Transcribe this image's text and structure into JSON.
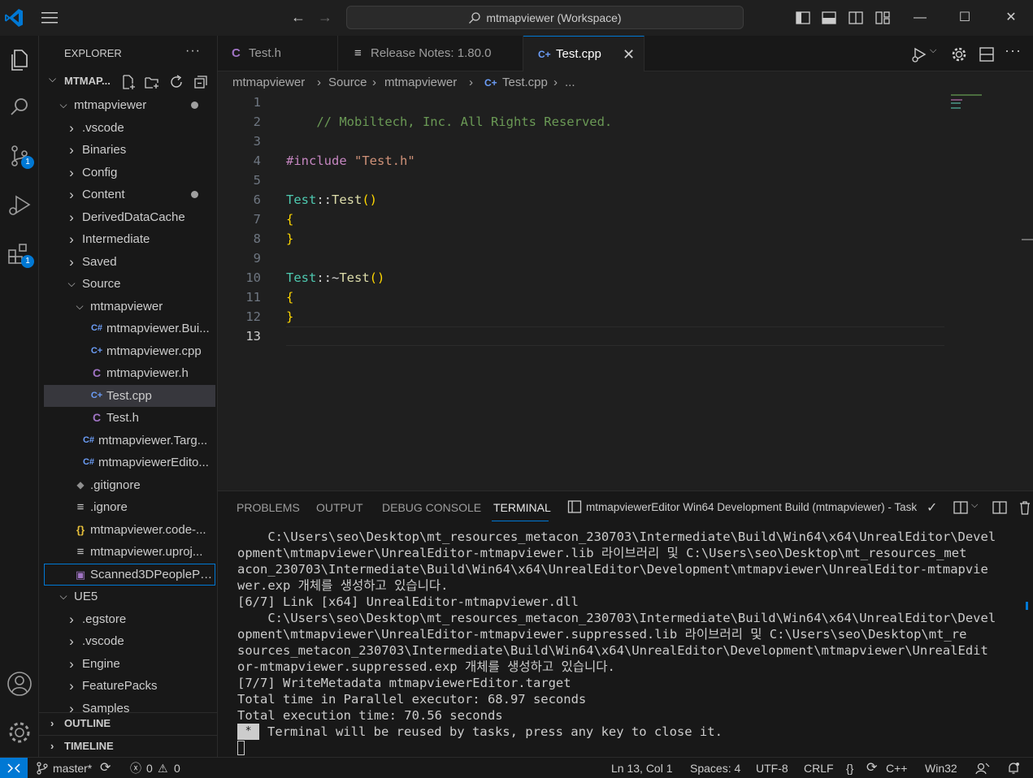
{
  "titlebar": {
    "search_text": "mtmapviewer (Workspace)",
    "back_icon": "arrow-left-icon",
    "forward_icon": "arrow-right-icon"
  },
  "activity_bar": {
    "scm_badge": "1",
    "extensions_badge": "1"
  },
  "sidebar": {
    "title": "EXPLORER",
    "workspace_label": "MTMAP...",
    "tree": [
      {
        "label": "mtmapviewer",
        "kind": "folder-open",
        "depth": 1,
        "modified": true
      },
      {
        "label": ".vscode",
        "kind": "folder",
        "depth": 2
      },
      {
        "label": "Binaries",
        "kind": "folder",
        "depth": 2
      },
      {
        "label": "Config",
        "kind": "folder",
        "depth": 2
      },
      {
        "label": "Content",
        "kind": "folder",
        "depth": 2,
        "modified": true
      },
      {
        "label": "DerivedDataCache",
        "kind": "folder",
        "depth": 2
      },
      {
        "label": "Intermediate",
        "kind": "folder",
        "depth": 2
      },
      {
        "label": "Saved",
        "kind": "folder",
        "depth": 2
      },
      {
        "label": "Source",
        "kind": "folder-open",
        "depth": 2
      },
      {
        "label": "mtmapviewer",
        "kind": "folder-open",
        "depth": 3
      },
      {
        "label": "mtmapviewer.Bui...",
        "kind": "csharp",
        "depth": 4
      },
      {
        "label": "mtmapviewer.cpp",
        "kind": "cpp",
        "depth": 4
      },
      {
        "label": "mtmapviewer.h",
        "kind": "c",
        "depth": 4
      },
      {
        "label": "Test.cpp",
        "kind": "cpp",
        "depth": 4,
        "selected": true
      },
      {
        "label": "Test.h",
        "kind": "c",
        "depth": 4
      },
      {
        "label": "mtmapviewer.Targ...",
        "kind": "csharp",
        "depth": 3
      },
      {
        "label": "mtmapviewerEdito...",
        "kind": "csharp",
        "depth": 3
      },
      {
        "label": ".gitignore",
        "kind": "git",
        "depth": 2
      },
      {
        "label": ".ignore",
        "kind": "lines",
        "depth": 2
      },
      {
        "label": "mtmapviewer.code-...",
        "kind": "json",
        "depth": 2
      },
      {
        "label": "mtmapviewer.uproj...",
        "kind": "lines",
        "depth": 2
      },
      {
        "label": "Scanned3DPeoplePa...",
        "kind": "image",
        "depth": 2,
        "focused": true
      },
      {
        "label": "UE5",
        "kind": "folder-open",
        "depth": 1
      },
      {
        "label": ".egstore",
        "kind": "folder",
        "depth": 2
      },
      {
        "label": ".vscode",
        "kind": "folder",
        "depth": 2
      },
      {
        "label": "Engine",
        "kind": "folder",
        "depth": 2
      },
      {
        "label": "FeaturePacks",
        "kind": "folder",
        "depth": 2
      },
      {
        "label": "Samples",
        "kind": "folder",
        "depth": 2
      }
    ],
    "outline_label": "OUTLINE",
    "timeline_label": "TIMELINE"
  },
  "tabs": [
    {
      "label": "Test.h",
      "icon": "C",
      "active": false
    },
    {
      "label": "Release Notes: 1.80.0",
      "icon": "≡",
      "active": false
    },
    {
      "label": "Test.cpp",
      "icon": "C+",
      "active": true,
      "close": "✕"
    }
  ],
  "breadcrumbs": [
    "mtmapviewer",
    "Source",
    "mtmapviewer",
    "Test.cpp",
    "..."
  ],
  "editor": {
    "lines": [
      {
        "n": "1"
      },
      {
        "n": "2"
      },
      {
        "n": "3"
      },
      {
        "n": "4"
      },
      {
        "n": "5"
      },
      {
        "n": "6"
      },
      {
        "n": "7"
      },
      {
        "n": "8"
      },
      {
        "n": "9"
      },
      {
        "n": "10"
      },
      {
        "n": "11"
      },
      {
        "n": "12"
      },
      {
        "n": "13"
      }
    ],
    "code": {
      "l1": "// Mobiltech, Inc. All Rights Reserved.",
      "l4_kw": "#include",
      "l4_str": "\"Test.h\"",
      "l6_type": "Test",
      "l6_sep": "::",
      "l6_fn": "Test",
      "l6_paren": "()",
      "open_brace": "{",
      "close_brace": "}",
      "l10_type": "Test",
      "l10_sep": "::~",
      "l10_fn": "Test",
      "l10_paren": "()"
    }
  },
  "panel": {
    "tabs": [
      "PROBLEMS",
      "OUTPUT",
      "DEBUG CONSOLE",
      "TERMINAL"
    ],
    "task_label": "mtmapviewerEditor Win64 Development Build (mtmapviewer) - Task",
    "terminal_lines": [
      "    C:\\Users\\seo\\Desktop\\mt_resources_metacon_230703\\Intermediate\\Build\\Win64\\x64\\UnrealEditor\\Devel",
      "opment\\mtmapviewer\\UnrealEditor-mtmapviewer.lib 라이브러리 및 C:\\Users\\seo\\Desktop\\mt_resources_met",
      "acon_230703\\Intermediate\\Build\\Win64\\x64\\UnrealEditor\\Development\\mtmapviewer\\UnrealEditor-mtmapvie",
      "wer.exp 개체를 생성하고 있습니다.",
      "[6/7] Link [x64] UnrealEditor-mtmapviewer.dll",
      "    C:\\Users\\seo\\Desktop\\mt_resources_metacon_230703\\Intermediate\\Build\\Win64\\x64\\UnrealEditor\\Devel",
      "opment\\mtmapviewer\\UnrealEditor-mtmapviewer.suppressed.lib 라이브러리 및 C:\\Users\\seo\\Desktop\\mt_re",
      "sources_metacon_230703\\Intermediate\\Build\\Win64\\x64\\UnrealEditor\\Development\\mtmapviewer\\UnrealEdit",
      "or-mtmapviewer.suppressed.exp 개체를 생성하고 있습니다.",
      "[7/7] WriteMetadata mtmapviewerEditor.target",
      "Total time in Parallel executor: 68.97 seconds",
      "Total execution time: 70.56 seconds"
    ],
    "final_marker": "*",
    "final_line": "Terminal will be reused by tasks, press any key to close it."
  },
  "statusbar": {
    "branch": "master*",
    "errors": "0",
    "warnings": "0",
    "position": "Ln 13, Col 1",
    "spaces": "Spaces: 4",
    "encoding": "UTF-8",
    "eol": "CRLF",
    "braces": "{}",
    "language": "C++",
    "platform": "Win32"
  },
  "colors": {
    "accent": "#0078d4",
    "comment": "#6a9955",
    "keyword": "#c586c0",
    "string": "#ce9178",
    "type": "#4ec9b0",
    "function": "#dcdcaa"
  }
}
